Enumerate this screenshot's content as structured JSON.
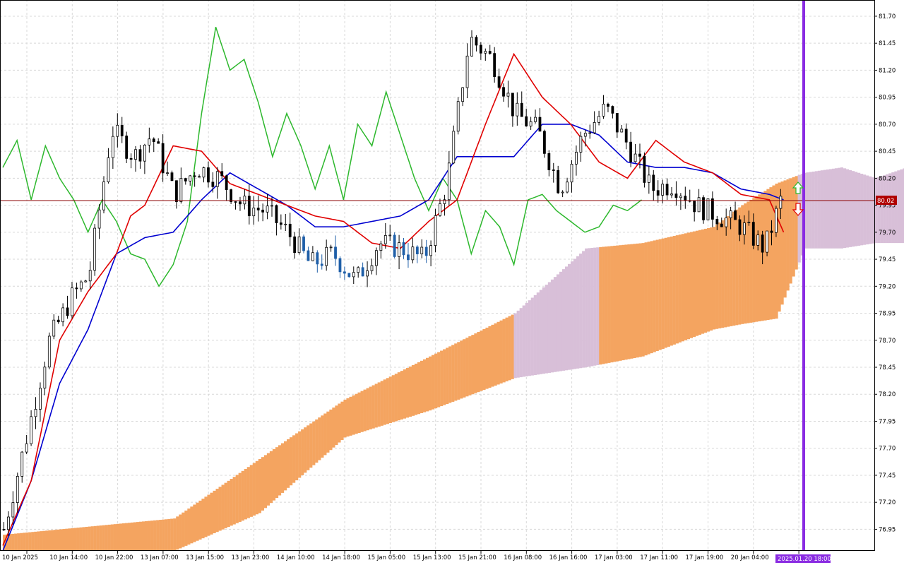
{
  "chart_data": {
    "type": "candlestick",
    "title": "",
    "y_ticks": [
      "81.70",
      "81.45",
      "81.20",
      "80.95",
      "80.70",
      "80.45",
      "80.20",
      "79.95",
      "79.70",
      "79.45",
      "79.20",
      "78.95",
      "78.70",
      "78.45",
      "78.20",
      "77.95",
      "77.70",
      "77.45",
      "77.20",
      "76.95"
    ],
    "ylim": [
      76.75,
      81.85
    ],
    "x_ticks": [
      "10 Jan 2025",
      "10 Jan 14:00",
      "10 Jan 22:00",
      "13 Jan 07:00",
      "13 Jan 15:00",
      "13 Jan 23:00",
      "14 Jan 10:00",
      "14 Jan 18:00",
      "15 Jan 05:00",
      "15 Jan 13:00",
      "15 Jan 21:00",
      "16 Jan 08:00",
      "16 Jan 16:00",
      "17 Jan 03:00",
      "17 Jan 11:00",
      "17 Jan 19:00",
      "20 Jan 04:00",
      "20"
    ],
    "current_price": "80.02",
    "marker_time_label": "2025.01.20 18:00",
    "grid": true,
    "colors": {
      "background": "#ffffff",
      "grid": "#d8d8d8",
      "bull_candle": "#ffffff",
      "bear_candle": "#000000",
      "inside_cloud_candle": "#1f5fa8",
      "tenkan_sen": "#e00000",
      "kijun_sen": "#0000d0",
      "chikou_span": "#2db82d",
      "kumo_bullish": "#f4a460",
      "kumo_bearish": "#d8bfd8",
      "price_line": "#8b0000",
      "marker_line": "#8a2be2",
      "up_arrow": "#2db82d",
      "down_arrow": "#e00000"
    },
    "series": [
      {
        "key": "kumo_top",
        "x": [
          0,
          60,
          90,
          120,
          150,
          180,
          205,
          225,
          250,
          260,
          272,
          282,
          295,
          307,
          318,
          331
        ],
        "values": [
          76.9,
          77.05,
          77.6,
          78.15,
          78.55,
          78.95,
          79.55,
          79.6,
          79.75,
          79.95,
          80.15,
          80.25,
          80.3,
          80.2,
          80.3,
          80.25
        ]
      },
      {
        "key": "kumo_bottom",
        "x": [
          0,
          60,
          90,
          120,
          150,
          180,
          205,
          225,
          250,
          260,
          272,
          282,
          295,
          307,
          318,
          331
        ],
        "values": [
          76.75,
          76.75,
          77.1,
          77.8,
          78.05,
          78.35,
          78.45,
          78.55,
          78.8,
          78.85,
          78.9,
          79.55,
          79.55,
          79.6,
          79.6,
          79.7
        ]
      },
      {
        "key": "tenkan_sen",
        "x": [
          0,
          10,
          20,
          30,
          40,
          45,
          50,
          60,
          70,
          80,
          90,
          100,
          110,
          120,
          130,
          140,
          150,
          160,
          170,
          180,
          190,
          200,
          210,
          220,
          230,
          240,
          250,
          260,
          270,
          275
        ],
        "values": [
          76.8,
          77.4,
          78.7,
          79.15,
          79.5,
          79.85,
          79.95,
          80.5,
          80.45,
          80.15,
          80.05,
          79.95,
          79.85,
          79.8,
          79.6,
          79.55,
          79.8,
          80.0,
          80.7,
          81.35,
          80.95,
          80.7,
          80.35,
          80.2,
          80.55,
          80.35,
          80.25,
          80.05,
          80.0,
          79.7
        ]
      },
      {
        "key": "kijun_sen",
        "x": [
          0,
          10,
          20,
          30,
          40,
          50,
          60,
          70,
          80,
          90,
          100,
          110,
          120,
          130,
          140,
          150,
          160,
          170,
          180,
          190,
          200,
          210,
          220,
          230,
          240,
          250,
          260,
          270,
          275
        ],
        "values": [
          76.75,
          77.4,
          78.3,
          78.8,
          79.5,
          79.65,
          79.7,
          80.0,
          80.25,
          80.1,
          79.95,
          79.75,
          79.75,
          79.8,
          79.85,
          80.0,
          80.4,
          80.4,
          80.4,
          80.7,
          80.7,
          80.6,
          80.35,
          80.3,
          80.3,
          80.25,
          80.1,
          80.05,
          80.0
        ]
      },
      {
        "key": "chikou_span",
        "x": [
          0,
          5,
          10,
          15,
          20,
          25,
          30,
          35,
          40,
          45,
          50,
          55,
          60,
          65,
          70,
          75,
          80,
          85,
          90,
          95,
          100,
          105,
          110,
          115,
          120,
          125,
          130,
          135,
          140,
          145,
          150,
          155,
          160,
          165,
          170,
          175,
          180,
          185,
          190,
          195,
          200,
          205,
          210,
          215,
          220,
          225
        ],
        "values": [
          80.3,
          80.55,
          80.0,
          80.5,
          80.2,
          80.0,
          79.7,
          80.0,
          79.8,
          79.5,
          79.45,
          79.2,
          79.4,
          79.8,
          80.8,
          81.6,
          81.2,
          81.3,
          80.9,
          80.4,
          80.8,
          80.5,
          80.1,
          80.5,
          80.0,
          80.7,
          80.5,
          81.0,
          80.6,
          80.2,
          79.9,
          80.2,
          80.0,
          79.5,
          79.9,
          79.75,
          79.4,
          80.0,
          80.05,
          79.9,
          79.8,
          79.7,
          79.75,
          79.95,
          79.9,
          80.0
        ]
      },
      {
        "key": "price_path",
        "x": [
          0,
          8,
          16,
          24,
          30,
          38,
          46,
          52,
          60,
          68,
          76,
          84,
          92,
          100,
          108,
          116,
          124,
          132,
          140,
          148,
          156,
          164,
          172,
          180,
          188,
          196,
          204,
          212,
          220,
          228,
          236,
          244,
          252,
          260,
          268,
          274
        ],
        "values": [
          76.95,
          77.8,
          78.7,
          79.1,
          79.3,
          80.65,
          80.4,
          80.6,
          80.05,
          80.3,
          80.2,
          79.95,
          79.9,
          79.7,
          79.4,
          79.5,
          79.25,
          79.6,
          79.55,
          79.45,
          80.15,
          81.5,
          81.3,
          80.8,
          80.65,
          80.1,
          80.6,
          80.85,
          80.5,
          80.1,
          80.15,
          79.95,
          79.85,
          79.75,
          79.55,
          80.02
        ]
      }
    ]
  }
}
